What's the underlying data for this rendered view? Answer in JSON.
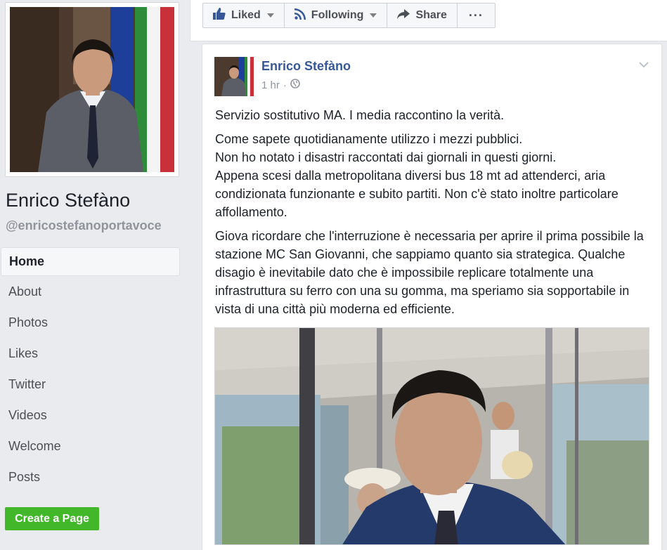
{
  "page": {
    "name": "Enrico Stefàno",
    "handle": "@enricostefanoportavoce"
  },
  "nav": [
    {
      "label": "Home",
      "active": true
    },
    {
      "label": "About"
    },
    {
      "label": "Photos"
    },
    {
      "label": "Likes"
    },
    {
      "label": "Twitter"
    },
    {
      "label": "Videos"
    },
    {
      "label": "Welcome"
    },
    {
      "label": "Posts"
    }
  ],
  "create_page_label": "Create a Page",
  "toolbar": {
    "liked": "Liked",
    "following": "Following",
    "share": "Share",
    "more": "···"
  },
  "post": {
    "author": "Enrico Stefàno",
    "time": "1 hr",
    "separator": "·",
    "paragraphs": [
      "Servizio sostitutivo MA. I media raccontino la verità.",
      "Come sapete quotidianamente utilizzo i mezzi pubblici.\nNon ho notato i disastri raccontati dai giornali in questi giorni.\nAppena scesi dalla metropolitana diversi bus 18 mt ad attenderci, aria condizionata funzionante e subito partiti. Non c'è stato inoltre particolare affollamento.",
      "Giova ricordare che l'interruzione è necessaria per aprire il prima possibile la stazione MC San Giovanni, che sappiamo quanto sia strategica. Qualche disagio è inevitabile dato che è impossibile replicare totalmente una infrastruttura su ferro con una su gomma, ma speriamo sia sopportabile in vista di una città più moderna ed efficiente."
    ]
  },
  "colors": {
    "link": "#365899",
    "create_button": "#42b72a",
    "background": "#e9ebee"
  },
  "icons": {
    "liked": "thumbs-up-icon",
    "following": "rss-icon",
    "share": "share-arrow-icon",
    "privacy": "globe-icon",
    "menu": "chevron-down-icon"
  }
}
